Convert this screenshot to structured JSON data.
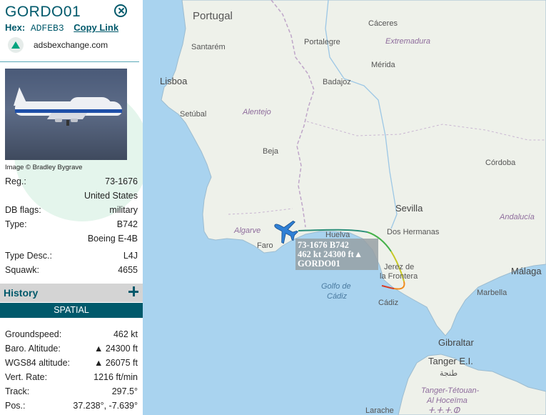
{
  "aircraft": {
    "callsign": "GORDO01",
    "hex_label": "Hex:",
    "hex": "ADFEB3",
    "copy_link": "Copy Link",
    "site": "adsbexchange.com",
    "image_credit": "Image © Bradley Bygrave"
  },
  "details": [
    {
      "label": "Reg.:",
      "value": "73-1676"
    },
    {
      "label": "",
      "value": "United States"
    },
    {
      "label": "DB flags:",
      "value": "military"
    },
    {
      "label": "Type:",
      "value": "B742"
    },
    {
      "label": "",
      "value": "Boeing E-4B"
    },
    {
      "label": "Type Desc.:",
      "value": "L4J"
    },
    {
      "label": "Squawk:",
      "value": "4655"
    }
  ],
  "history": {
    "title": "History",
    "tab": "SPATIAL"
  },
  "spatial": [
    {
      "label": "Groundspeed:",
      "value": "462 kt"
    },
    {
      "label": "Baro. Altitude:",
      "value": "▲ 24300 ft"
    },
    {
      "label": "WGS84 altitude:",
      "value": "▲ 26075 ft"
    },
    {
      "label": "Vert. Rate:",
      "value": "1216 ft/min"
    },
    {
      "label": "Track:",
      "value": "297.5°"
    },
    {
      "label": "Pos.:",
      "value": "37.238°, -7.639°"
    }
  ],
  "map": {
    "labels": {
      "portugal": "Portugal",
      "caceres": "Cáceres",
      "portalegre": "Portalegre",
      "extremadura": "Extremadura",
      "santarem": "Santarém",
      "merida": "Mérida",
      "lisboa": "Lisboa",
      "badajoz": "Badajoz",
      "setubal": "Setúbal",
      "alentejo": "Alentejo",
      "beja": "Beja",
      "cordoba": "Córdoba",
      "sevilla": "Sevilla",
      "andalucia": "Andalucía",
      "algarve": "Algarve",
      "huelva": "Huelva",
      "dos_hermanas": "Dos Hermanas",
      "faro": "Faro",
      "jerez1": "Jerez de",
      "jerez2": "la Frontera",
      "malaga": "Málaga",
      "golfo1": "Golfo de",
      "golfo2": "Cádiz",
      "cadiz": "Cádiz",
      "marbella": "Marbella",
      "gibraltar": "Gibraltar",
      "tanger": "Tanger E.I.",
      "tanger_ar": "طنجة",
      "tth1": "Tanger-Tétouan-",
      "tth2": "Al Hoceïma",
      "tth3": "ⵜ.ⵜ.ⵜ.ⵀ",
      "larache": "Larache"
    },
    "aircraft_label": {
      "line1": "73-1676 B742",
      "line2": "462 kt  24300 ft▲",
      "line3": "GORDO01"
    },
    "colors": {
      "land": "#eef1ea",
      "sea": "#a9d3ef",
      "aircraft": "#2f80d6"
    }
  }
}
